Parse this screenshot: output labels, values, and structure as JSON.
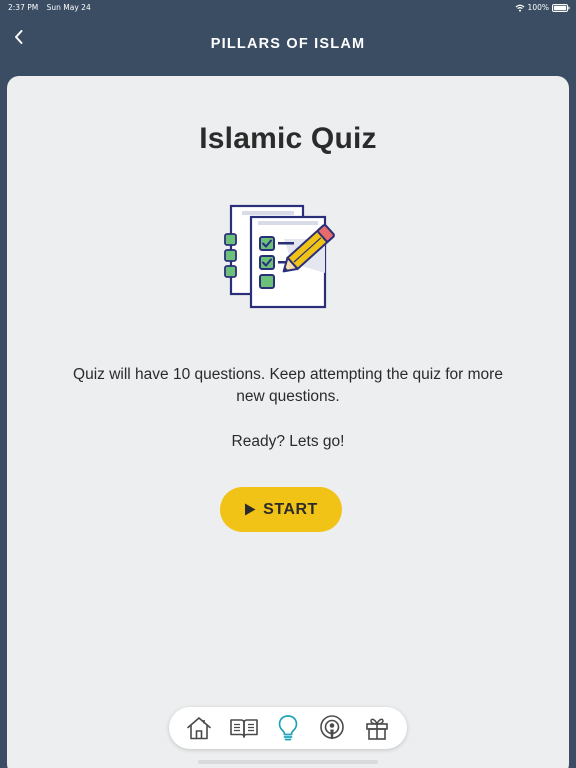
{
  "status_bar": {
    "time": "2:37 PM",
    "date": "Sun May 24",
    "battery": "100%"
  },
  "header": {
    "title": "PILLARS OF ISLAM",
    "back_icon": "chevron-left-icon"
  },
  "quiz": {
    "title": "Islamic Quiz",
    "description": "Quiz will have 10 questions. Keep attempting the quiz for more new questions.",
    "ready_text": "Ready? Lets go!",
    "start_label": "START",
    "start_icon": "play-icon",
    "illustration": "checklist-pencil-icon"
  },
  "tab_bar": {
    "items": [
      {
        "icon": "home-icon",
        "active": false
      },
      {
        "icon": "book-icon",
        "active": false
      },
      {
        "icon": "lightbulb-icon",
        "active": true
      },
      {
        "icon": "podcast-icon",
        "active": false
      },
      {
        "icon": "gift-icon",
        "active": false
      }
    ]
  },
  "colors": {
    "background": "#3b4d63",
    "card": "#eceeef",
    "accent": "#f1c317",
    "active_tab": "#1fa3b8",
    "inactive_tab": "#4a4a4a"
  }
}
